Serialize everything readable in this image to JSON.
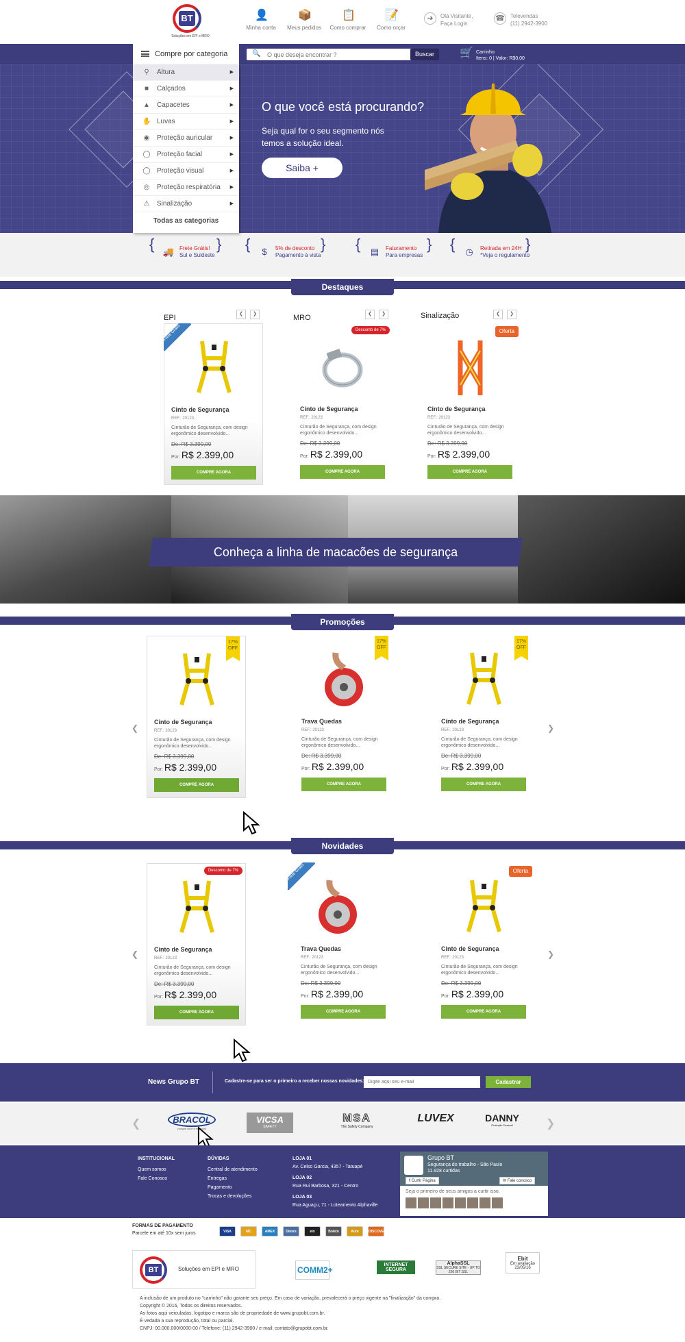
{
  "header": {
    "logo_text": "BT",
    "logo_tagline": "Soluções em EPI e MRO",
    "links": [
      {
        "label": "Minha conta",
        "icon": "user-icon"
      },
      {
        "label": "Meus pedidos",
        "icon": "orders-icon"
      },
      {
        "label": "Como comprar",
        "icon": "clipboard-icon"
      },
      {
        "label": "Como orçar",
        "icon": "quote-icon"
      }
    ],
    "visitor_line1": "Olá Visitante,",
    "visitor_line2": "Faça Login",
    "sales_line1": "Televendas",
    "sales_line2": "(11) 2942-3900"
  },
  "navbar": {
    "category_button": "Compre por categoria",
    "search_placeholder": "O que deseja encontrar ?",
    "search_button": "Buscar",
    "cart_title": "Carrinho",
    "cart_info": "Itens: 0 | Valor: R$0,00"
  },
  "categories": {
    "items": [
      {
        "label": "Altura",
        "icon": "height-harness-icon"
      },
      {
        "label": "Calçados",
        "icon": "boot-icon"
      },
      {
        "label": "Capacetes",
        "icon": "helmet-icon"
      },
      {
        "label": "Luvas",
        "icon": "glove-icon"
      },
      {
        "label": "Proteção auricular",
        "icon": "ear-protection-icon"
      },
      {
        "label": "Proteção facial",
        "icon": "face-shield-icon"
      },
      {
        "label": "Proteção visual",
        "icon": "goggles-icon"
      },
      {
        "label": "Proteção respiratória",
        "icon": "respirator-icon"
      },
      {
        "label": "Sinalização",
        "icon": "sign-icon"
      }
    ],
    "all": "Todas as categorias"
  },
  "hero": {
    "title": "O que você está procurando?",
    "text": "Seja qual for o seu segmento nós temos a solução ideal.",
    "button": "Saiba +"
  },
  "benefits": [
    {
      "line1": "Frete Grátis!",
      "line2": "Sul e Suldeste"
    },
    {
      "line1": "5% de desconto",
      "line2": "Pagamento à vista"
    },
    {
      "line1": "Faturamento",
      "line2": "Para empresas"
    },
    {
      "line1": "Retirada em 24H",
      "line2": "*Veja o regulamento"
    }
  ],
  "destaques": {
    "title": "Destaques",
    "columns": [
      {
        "category": "EPI",
        "badge": "Frete Grátis",
        "name": "Cinto de Segurança",
        "ref": "REF.: 20123",
        "desc": "Cinturão de Segurança, com design ergonômico desenvolvido...",
        "old": "De: R$ 3.399,00",
        "por": "Por:",
        "price": "R$ 2.399,00",
        "buy": "COMPRE AGORA"
      },
      {
        "category": "MRO",
        "badge": "Desconto de 7%",
        "name": "Cinto de Segurança",
        "ref": "REF.: 20123",
        "desc": "Cinturão de Segurança, com design ergonômico desenvolvido...",
        "old": "De: R$ 3.399,00",
        "por": "Por:",
        "price": "R$ 2.399,00",
        "buy": "COMPRE AGORA"
      },
      {
        "category": "Sinalização",
        "badge": "Oferta",
        "name": "Cinto de Segurança",
        "ref": "REF.: 20123",
        "desc": "Cinturão de Segurança, com design ergonômico desenvolvido...",
        "old": "De: R$ 3.399,00",
        "por": "Por:",
        "price": "R$ 2.399,00",
        "buy": "COMPRE AGORA"
      }
    ]
  },
  "banner": {
    "text": "Conheça a linha de macacões de segurança"
  },
  "promocoes": {
    "title": "Promoções",
    "items": [
      {
        "badge": "17% OFF",
        "name": "Cinto de Segurança",
        "ref": "REF.: 20123",
        "desc": "Cinturão de Segurança, com design ergonômico desenvolvido...",
        "old": "De: R$ 3.399,00",
        "por": "Por:",
        "price": "R$ 2.399,00",
        "buy": "COMPRE AGORA"
      },
      {
        "badge": "17% OFF",
        "name": "Trava Quedas",
        "ref": "REF.: 20123",
        "desc": "Cinturão de Segurança, com design ergonômico desenvolvido...",
        "old": "De: R$ 3.399,00",
        "por": "Por:",
        "price": "R$ 2.399,00",
        "buy": "COMPRE AGORA"
      },
      {
        "badge": "17% OFF",
        "name": "Cinto de Segurança",
        "ref": "REF.: 20123",
        "desc": "Cinturão de Segurança, com design ergonômico desenvolvido...",
        "old": "De: R$ 3.399,00",
        "por": "Por:",
        "price": "R$ 2.399,00",
        "buy": "COMPRE AGORA"
      }
    ]
  },
  "novidades": {
    "title": "Novidades",
    "items": [
      {
        "badge": "Desconto de 7%",
        "name": "Cinto de Segurança",
        "ref": "REF.: 20123",
        "desc": "Cinturão de Segurança, com design ergonômico desenvolvido...",
        "old": "De: R$ 3.399,00",
        "por": "Por:",
        "price": "R$ 2.399,00",
        "buy": "COMPRE AGORA"
      },
      {
        "badge": "Frete Grátis",
        "name": "Trava Quedas",
        "ref": "REF.: 20123",
        "desc": "Cinturão de Segurança, com design ergonômico desenvolvido...",
        "old": "De: R$ 3.399,00",
        "por": "Por:",
        "price": "R$ 2.399,00",
        "buy": "COMPRE AGORA"
      },
      {
        "badge": "Oferta",
        "name": "Cinto de Segurança",
        "ref": "REF.: 20123",
        "desc": "Cinturão de Segurança, com design ergonômico desenvolvido...",
        "old": "De: R$ 3.399,00",
        "por": "Por:",
        "price": "R$ 2.399,00",
        "buy": "COMPRE AGORA"
      }
    ]
  },
  "news": {
    "title": "News Grupo BT",
    "desc": "Cadastre-se para ser o primeiro a receber nossas novidades:",
    "placeholder": "Digite aqui seu e-mail",
    "button": "Cadastrar"
  },
  "brands": [
    "BRACOL",
    "VICSA",
    "MSA",
    "LUVEX",
    "DANNY"
  ],
  "brand_subs": [
    "porque você é especial",
    "SAFETY",
    "The Safety Company",
    "",
    "Proteção Pessoal"
  ],
  "footer": {
    "institucional": {
      "title": "INSTITUCIONAL",
      "links": [
        "Quem somos",
        "Fale Conosco"
      ]
    },
    "duvidas": {
      "title": "DÚVIDAS",
      "links": [
        "Central de atendimento",
        "Entregas",
        "Pagamento",
        "Trocas e devoluções"
      ]
    },
    "lojas": [
      {
        "name": "LOJA 01",
        "addr": "Av. Celso Garcia, 4357 - Tatuapé"
      },
      {
        "name": "LOJA 02",
        "addr": "Rua Rui Barbosa, 321 - Centro"
      },
      {
        "name": "LOJA 03",
        "addr": "Rua Aguaçu, 71 - Loteamento Alphaville"
      }
    ],
    "facebook": {
      "name": "Grupo BT",
      "sub": "Segurança do trabalho - São Paulo",
      "likes": "11.928 curtidas",
      "like_btn": "Curtir Página",
      "contact_btn": "Fale conosco",
      "prompt": "Seja o primeiro de seus amigos a curtir isso."
    }
  },
  "payment": {
    "title": "FORMAS DE PAGAMENTO",
    "sub": "Parcele em até 10x sem juros",
    "cards": [
      {
        "label": "VISA",
        "color": "#1a3e8c"
      },
      {
        "label": "MC",
        "color": "#e3a21a"
      },
      {
        "label": "AMEX",
        "color": "#2a7fc0"
      },
      {
        "label": "Diners",
        "color": "#4a6fa0"
      },
      {
        "label": "elo",
        "color": "#222222"
      },
      {
        "label": "Boleto",
        "color": "#555555"
      },
      {
        "label": "Aura",
        "color": "#d49a1a"
      },
      {
        "label": "DISCOVER",
        "color": "#e06a1a"
      }
    ]
  },
  "bottom": {
    "logo_text": "Soluções em EPI e MRO",
    "seals": [
      "COMM2+",
      "INTERNET SEGURA",
      "AlphaSSL",
      "Ebit"
    ],
    "seal_subs": [
      "",
      "",
      "SSL SECURE SITE · UP TO 256 BIT SSL",
      "Em avaliação 23/05/16"
    ],
    "copy": [
      "A inclusão de um produto no \"carrinho\" não garante seu preço. Em caso de variação, prevalecerá o preço vigente na \"finalização\" da compra.",
      "Copyright © 2016, Todos os direitos reservados.",
      "As fotos aqui veiculadas, logotipo e marca são de propriedade de www.grupobt.com.br.",
      "É vedada a sua reprodução, total ou parcial.",
      "CNPJ: 00.000.000/0000-00 / Telefone: (11) 2942-3900 / e-mail: contato@grupobt.com.br."
    ]
  }
}
